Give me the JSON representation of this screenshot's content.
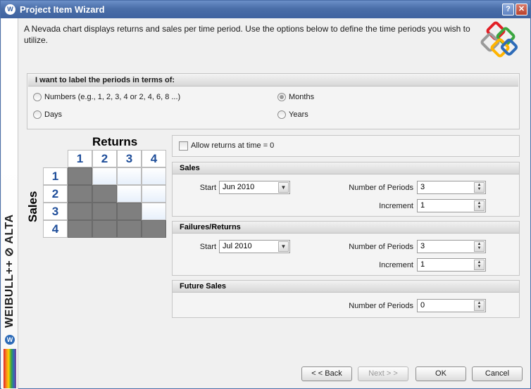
{
  "window": {
    "title": "Project Item Wizard",
    "help_label": "?",
    "close_label": "✕"
  },
  "brand": {
    "product_text": "WEIBULL++ ⊘ ALTA",
    "logo_glyph": "W"
  },
  "intro": "A Nevada chart displays returns and sales per time period. Use the options below to define the time periods you wish to utilize.",
  "period_group": {
    "title": "I want to label the periods in terms of:",
    "options": [
      {
        "label": "Numbers (e.g., 1, 2, 3, 4 or 2, 4, 6, 8 ...)",
        "selected": false
      },
      {
        "label": "Months",
        "selected": true
      },
      {
        "label": "Days",
        "selected": false
      },
      {
        "label": "Years",
        "selected": false
      }
    ]
  },
  "nevada": {
    "returns_label": "Returns",
    "sales_label": "Sales",
    "columns": [
      "1",
      "2",
      "3",
      "4"
    ],
    "rows": [
      "1",
      "2",
      "3",
      "4"
    ]
  },
  "allow_returns": {
    "label": "Allow returns at time = 0",
    "checked": false
  },
  "sales": {
    "title": "Sales",
    "start_label": "Start",
    "start_value": "Jun 2010",
    "periods_label": "Number of Periods",
    "periods_value": "3",
    "increment_label": "Increment",
    "increment_value": "1"
  },
  "failures": {
    "title": "Failures/Returns",
    "start_label": "Start",
    "start_value": "Jul 2010",
    "periods_label": "Number of Periods",
    "periods_value": "3",
    "increment_label": "Increment",
    "increment_value": "1"
  },
  "future": {
    "title": "Future Sales",
    "periods_label": "Number of Periods",
    "periods_value": "0"
  },
  "buttons": {
    "back": "< < Back",
    "next": "Next > >",
    "ok": "OK",
    "cancel": "Cancel"
  },
  "colors": {
    "title_bar": "#4a6ea8",
    "shaded_cell": "#7f7f7f",
    "header_number": "#1f4e9a"
  }
}
